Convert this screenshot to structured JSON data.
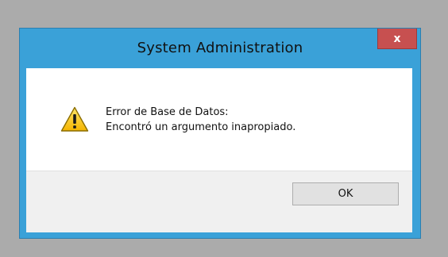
{
  "dialog": {
    "title": "System Administration",
    "close_label": "x",
    "icon": "warning-icon",
    "message_line1": "Error de Base de Datos:",
    "message_line2": "Encontró un argumento inapropiado.",
    "ok_label": "OK"
  },
  "colors": {
    "titlebar": "#3aa1d8",
    "close": "#c75050",
    "desktop": "#ababab"
  }
}
